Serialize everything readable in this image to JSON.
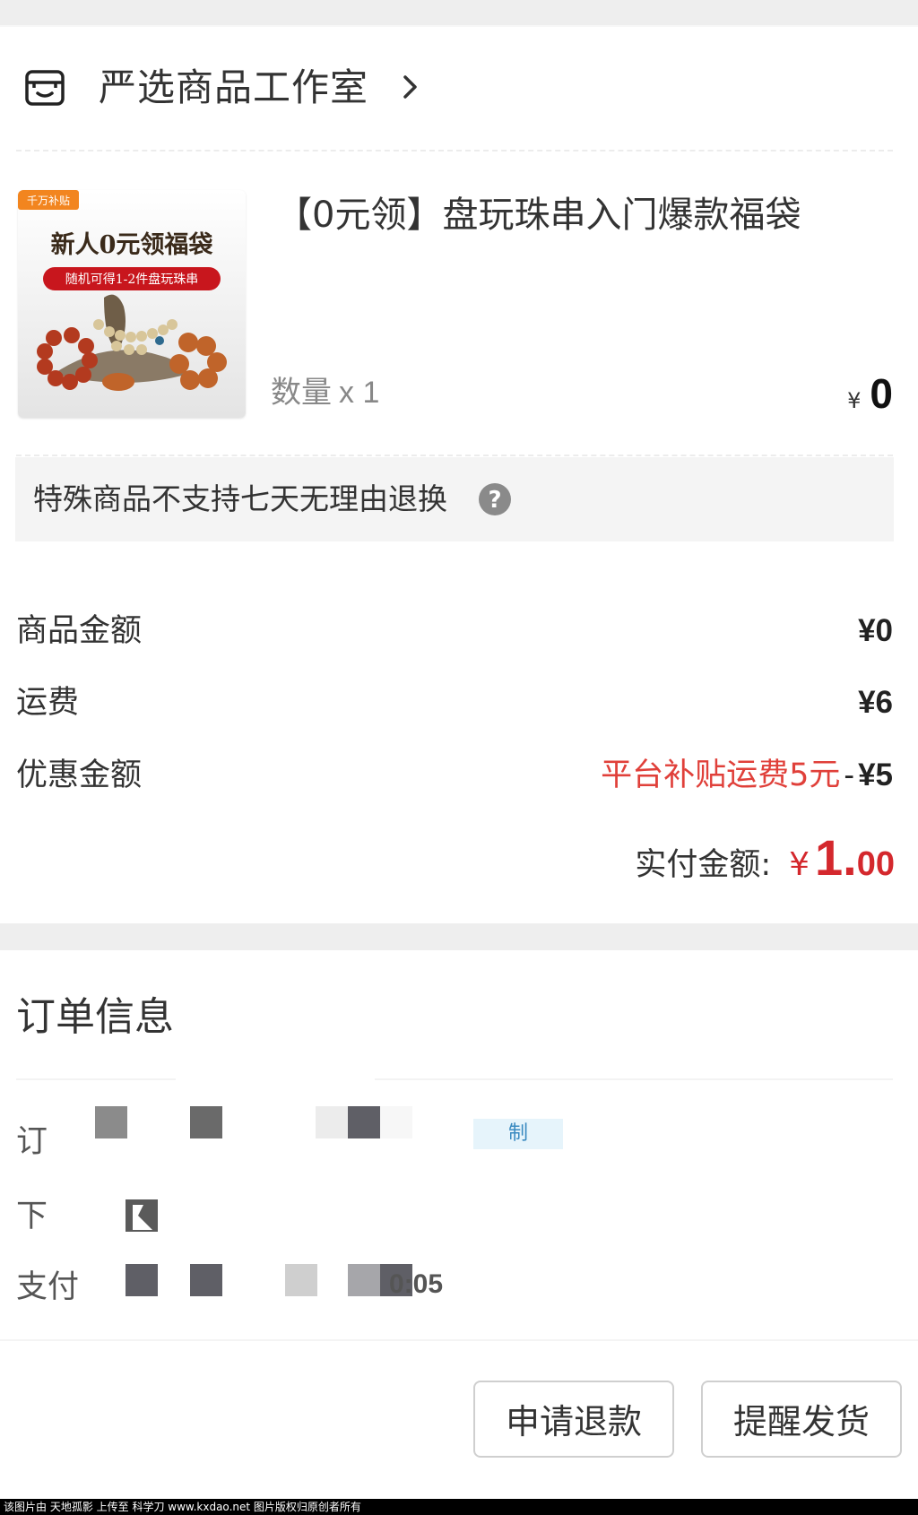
{
  "shop": {
    "name": "严选商品工作室",
    "icon": "store-face-icon",
    "chevron_icon": "chevron-right-icon"
  },
  "product": {
    "badge": "千万补贴",
    "image_headline": "新人0元领福袋",
    "image_subline": "随机可得1-2件盘玩珠串",
    "title": "【0元领】盘玩珠串入门爆款福袋",
    "quantity_label": "数量",
    "quantity_value": "x 1",
    "price_currency": "¥",
    "price_value": "0"
  },
  "notice": {
    "text": "特殊商品不支持七天无理由退换",
    "icon": "help-circle-icon"
  },
  "summary": {
    "goods_amount_label": "商品金额",
    "goods_amount_value": "¥0",
    "shipping_label": "运费",
    "shipping_value": "¥6",
    "discount_label": "优惠金额",
    "discount_tag": "平台补贴运费5元",
    "discount_sep": "-",
    "discount_value": "¥5",
    "paid_label": "实付金额:",
    "paid_currency": "¥",
    "paid_integer": "1.",
    "paid_decimal": "00"
  },
  "order_info": {
    "title": "订单信息",
    "order_no_label": "订",
    "copy_label": "制",
    "order_time_label": "下",
    "pay_time_label": "支付",
    "pay_time_partial": "0:05"
  },
  "actions": {
    "refund_label": "申请退款",
    "remind_label": "提醒发货"
  },
  "watermark": "该图片由 天地孤影 上传至 科学刀 www.kxdao.net 图片版权归原创者所有",
  "colors": {
    "accent_red": "#d4282d",
    "promo_red": "#e0403a",
    "bg_gray": "#eeeeee"
  }
}
